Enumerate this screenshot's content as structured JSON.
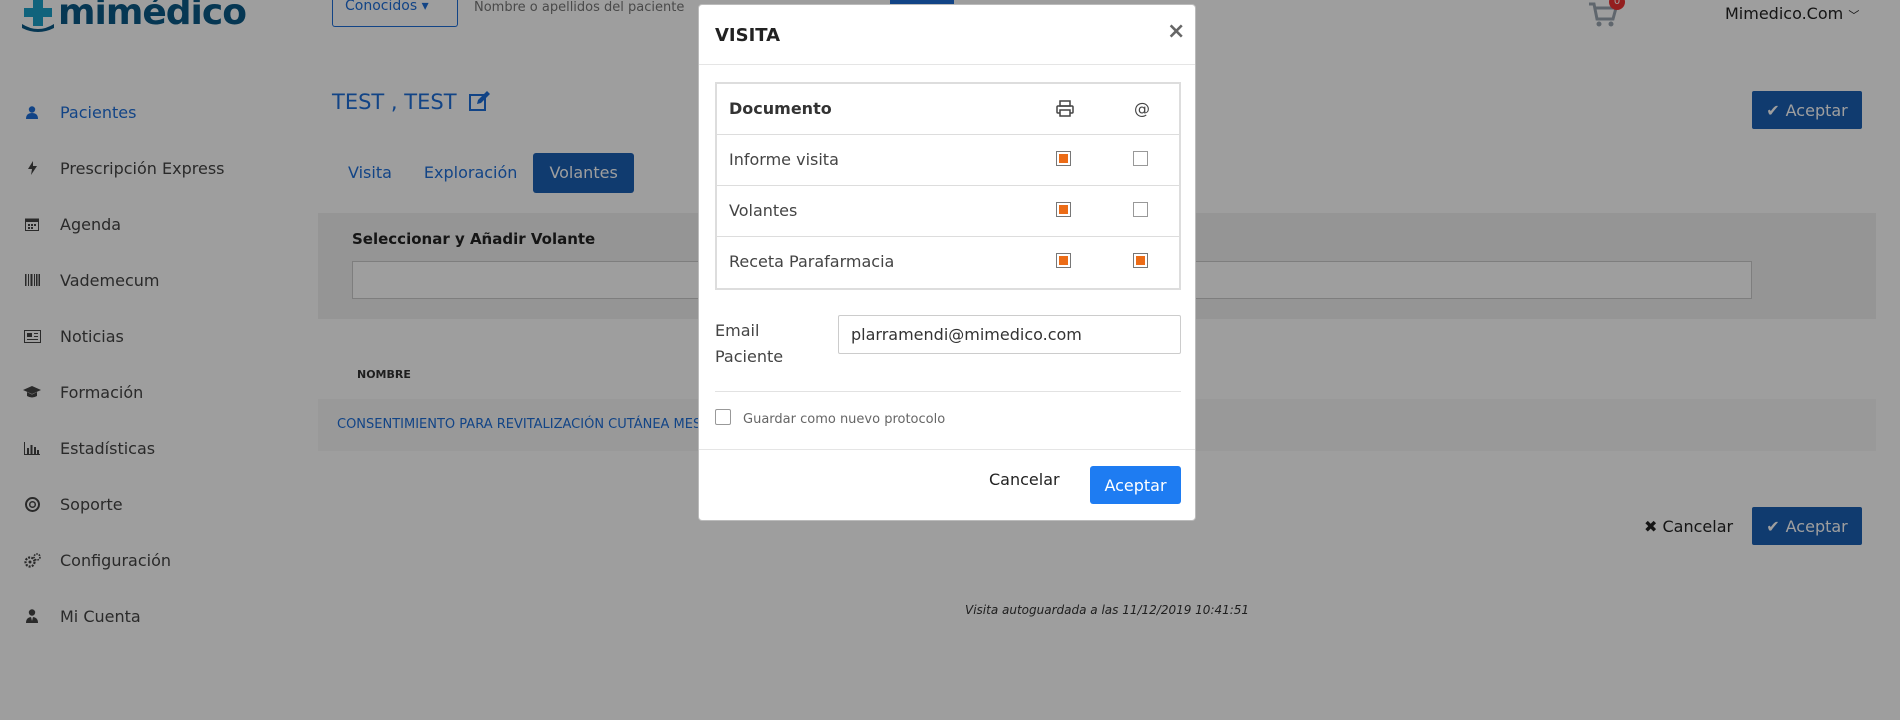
{
  "header": {
    "logo_text": "mimédico",
    "conocidos_label": "Conocidos",
    "search_placeholder": "Nombre o apellidos del paciente",
    "cart_count": "0",
    "user_label": "Mimedico.Com"
  },
  "sidebar": {
    "items": [
      {
        "label": "Pacientes",
        "icon": "user-icon"
      },
      {
        "label": "Prescripción Express",
        "icon": "bolt-icon"
      },
      {
        "label": "Agenda",
        "icon": "calendar-icon"
      },
      {
        "label": "Vademecum",
        "icon": "barcode-icon"
      },
      {
        "label": "Noticias",
        "icon": "newspaper-icon"
      },
      {
        "label": "Formación",
        "icon": "graduation-cap-icon"
      },
      {
        "label": "Estadísticas",
        "icon": "bar-chart-icon"
      },
      {
        "label": "Soporte",
        "icon": "lifebuoy-icon"
      },
      {
        "label": "Configuración",
        "icon": "cogs-icon"
      },
      {
        "label": "Mi Cuenta",
        "icon": "user-tie-icon"
      }
    ]
  },
  "main": {
    "patient_name": "TEST , TEST",
    "tabs": [
      {
        "label": "Visita"
      },
      {
        "label": "Exploración"
      },
      {
        "label": "Volantes"
      }
    ],
    "accept_label": "Aceptar",
    "volante_label": "Seleccionar y Añadir Volante",
    "column_nombre": "NOMBRE",
    "row_text": "CONSENTIMIENTO PARA REVITALIZACIÓN CUTÁNEA MES",
    "cancel_label": "Cancelar",
    "autosave_text": "Visita autoguardada a las 11/12/2019 10:41:51"
  },
  "modal": {
    "title": "VISITA",
    "close_symbol": "×",
    "table_header": "Documento",
    "mail_header": "@",
    "documents": [
      {
        "name": "Informe visita",
        "print": true,
        "email": false
      },
      {
        "name": "Volantes",
        "print": true,
        "email": false
      },
      {
        "name": "Receta Parafarmacia",
        "print": true,
        "email": true
      }
    ],
    "email_label_line1": "Email",
    "email_label_line2": "Paciente",
    "email_value": "plarramendi@mimedico.com",
    "protocol_label": "Guardar como nuevo protocolo",
    "cancel_label": "Cancelar",
    "accept_label": "Aceptar"
  },
  "colors": {
    "primary": "#1e6fd9",
    "button_dark": "#1a5fb4",
    "check_orange": "#ec6c17",
    "backdrop": "rgba(0,0,0,0.38)"
  }
}
